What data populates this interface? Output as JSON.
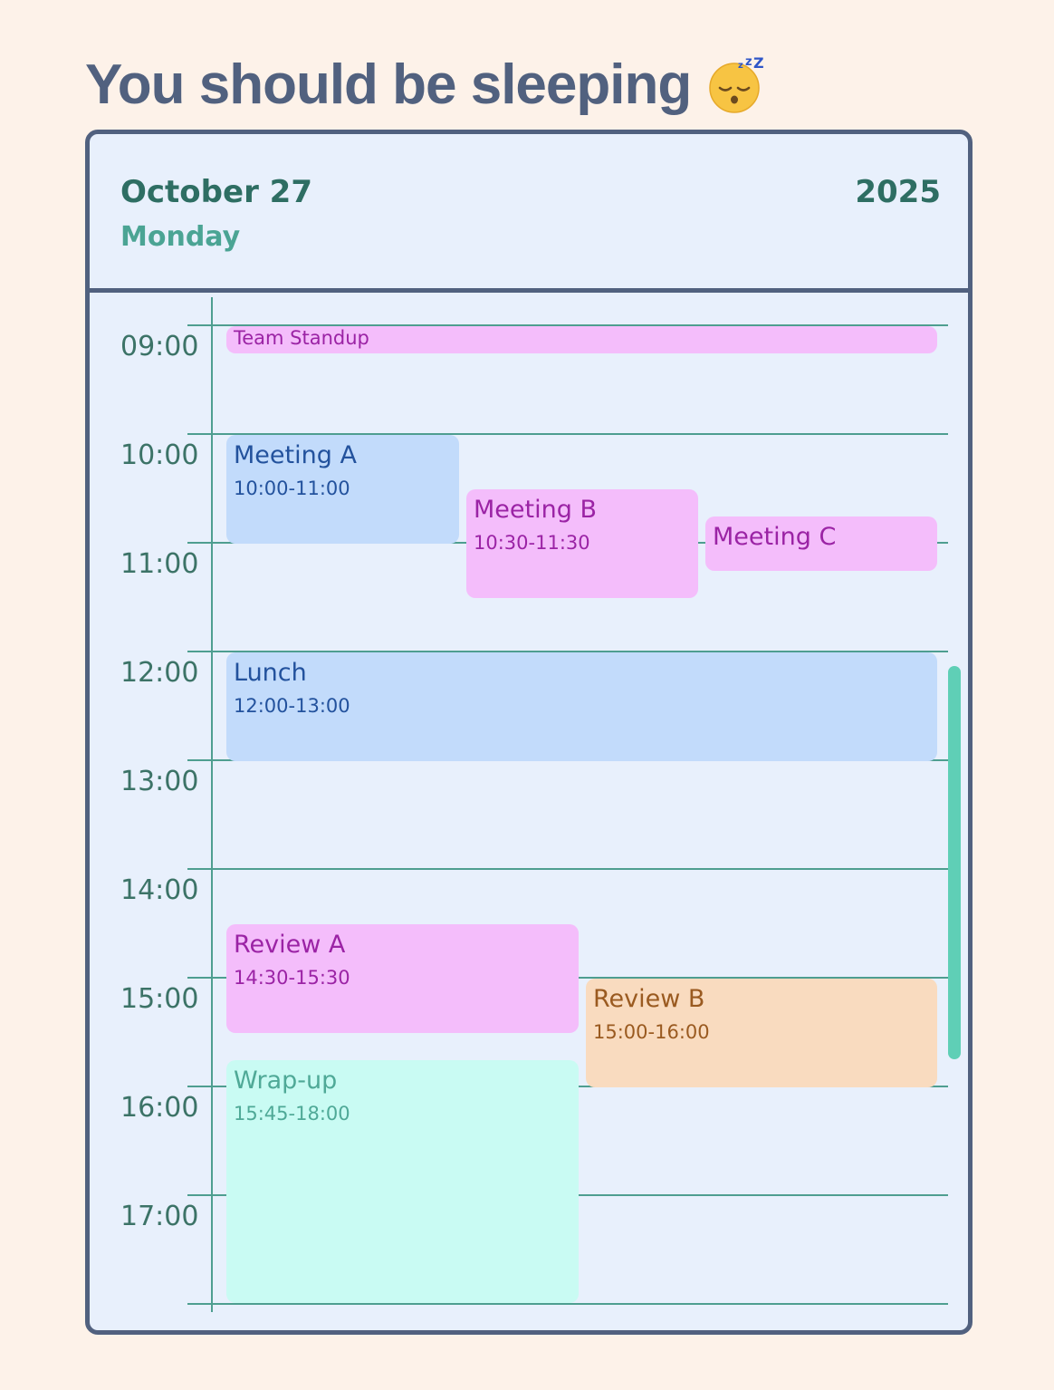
{
  "header": {
    "title": "You should be sleeping",
    "title_emoji": "sleeping-face-icon"
  },
  "calendar": {
    "date": "October 27",
    "year": "2025",
    "weekday": "Monday",
    "hours": [
      "09:00",
      "10:00",
      "11:00",
      "12:00",
      "13:00",
      "14:00",
      "15:00",
      "16:00",
      "17:00"
    ],
    "events": [
      {
        "title": "Team Standup",
        "time": ""
      },
      {
        "title": "Meeting A",
        "time": "10:00-11:00"
      },
      {
        "title": "Meeting B",
        "time": "10:30-11:30"
      },
      {
        "title": "Meeting C",
        "time": ""
      },
      {
        "title": "Lunch",
        "time": "12:00-13:00"
      },
      {
        "title": "Review A",
        "time": "14:30-15:30"
      },
      {
        "title": "Review B",
        "time": "15:00-16:00"
      },
      {
        "title": "Wrap-up",
        "time": "15:45-18:00"
      }
    ]
  },
  "colors": {
    "page_bg": "#fdf2e9",
    "card_bg": "#e8f0fc",
    "border": "#51617f",
    "accent": "#4e9e90",
    "pink": "#f4bdfb",
    "blue": "#c2dbfb",
    "orange": "#f9dbbf",
    "mint": "#c9fbf3",
    "scrollbar": "#5fcfb6"
  }
}
